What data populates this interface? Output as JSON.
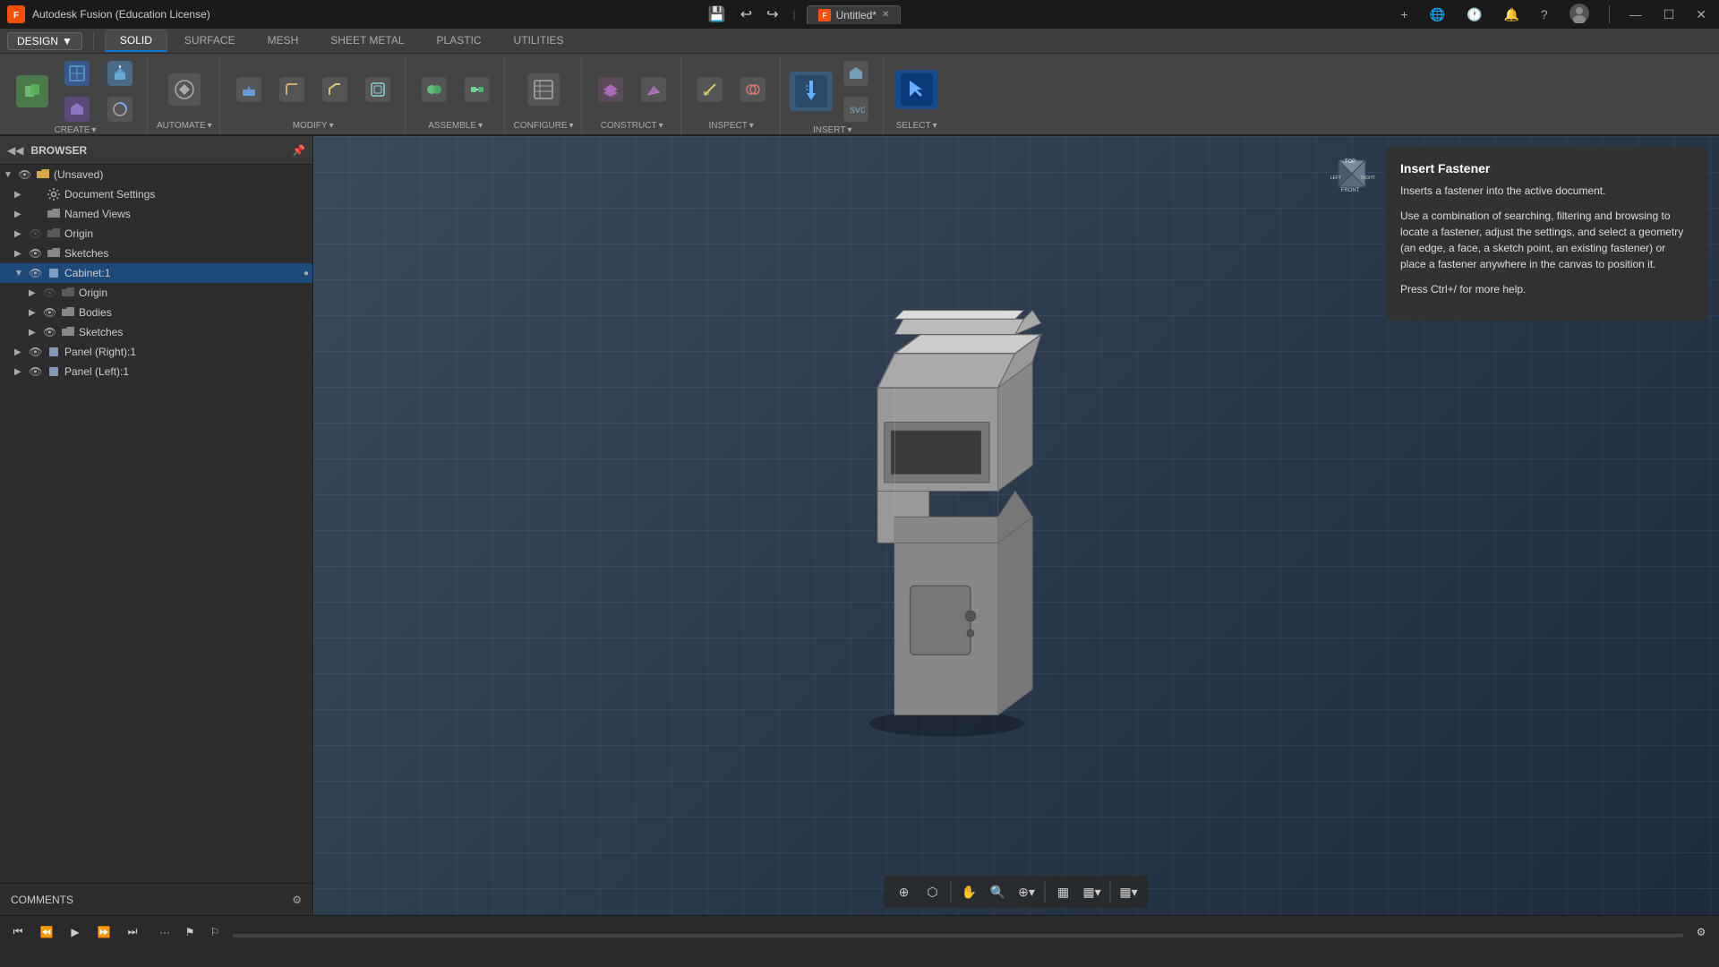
{
  "app": {
    "title": "Autodesk Fusion (Education License)",
    "doc_title": "Untitled*",
    "close_btn": "✕",
    "maximize_btn": "☐",
    "minimize_btn": "—"
  },
  "toolbar": {
    "tabs": [
      "SOLID",
      "SURFACE",
      "MESH",
      "SHEET METAL",
      "PLASTIC",
      "UTILITIES"
    ],
    "active_tab": "SOLID",
    "groups": [
      {
        "label": "CREATE",
        "buttons": [
          "New Component",
          "Create Sketch",
          "Create Form",
          "Extrude"
        ]
      },
      {
        "label": "AUTOMATE",
        "buttons": [
          "Automate"
        ]
      },
      {
        "label": "MODIFY",
        "buttons": [
          "Press Pull",
          "Fillet",
          "Chamfer",
          "Shell"
        ]
      },
      {
        "label": "ASSEMBLE",
        "buttons": [
          "New Joint",
          "As-Built Joint"
        ]
      },
      {
        "label": "CONFIGURE",
        "buttons": [
          "Configure"
        ]
      },
      {
        "label": "CONSTRUCT",
        "buttons": [
          "Offset Plane",
          "Plane at Angle"
        ]
      },
      {
        "label": "INSPECT",
        "buttons": [
          "Measure",
          "Interference"
        ]
      },
      {
        "label": "INSERT",
        "buttons": [
          "Insert Mesh",
          "Insert SVG",
          "Insert Fastener"
        ]
      },
      {
        "label": "SELECT",
        "buttons": [
          "Select"
        ]
      }
    ]
  },
  "design_mode": {
    "label": "DESIGN",
    "arrow": "▼"
  },
  "browser": {
    "title": "BROWSER",
    "items": [
      {
        "id": "unsaved",
        "label": "(Unsaved)",
        "indent": 0,
        "expanded": true,
        "type": "root"
      },
      {
        "id": "doc-settings",
        "label": "Document Settings",
        "indent": 1,
        "type": "settings"
      },
      {
        "id": "named-views",
        "label": "Named Views",
        "indent": 1,
        "type": "folder"
      },
      {
        "id": "origin",
        "label": "Origin",
        "indent": 1,
        "type": "folder",
        "hidden": true
      },
      {
        "id": "sketches",
        "label": "Sketches",
        "indent": 1,
        "type": "folder"
      },
      {
        "id": "cabinet",
        "label": "Cabinet:1",
        "indent": 1,
        "type": "component",
        "selected": true
      },
      {
        "id": "origin2",
        "label": "Origin",
        "indent": 2,
        "type": "folder",
        "hidden": true
      },
      {
        "id": "bodies",
        "label": "Bodies",
        "indent": 2,
        "type": "folder"
      },
      {
        "id": "sketches2",
        "label": "Sketches",
        "indent": 2,
        "type": "folder"
      },
      {
        "id": "panel-right",
        "label": "Panel (Right):1",
        "indent": 1,
        "type": "component"
      },
      {
        "id": "panel-left",
        "label": "Panel (Left):1",
        "indent": 1,
        "type": "component"
      }
    ]
  },
  "tooltip": {
    "title": "Insert Fastener",
    "desc1": "Inserts a fastener into the active document.",
    "desc2": "Use a combination of searching, filtering and browsing to locate a fastener, adjust the settings, and select a geometry (an edge, a face, a sketch point, an existing fastener) or place a fastener anywhere in the canvas to position it.",
    "help_hint": "Press Ctrl+/ for more help."
  },
  "comments": {
    "label": "COMMENTS",
    "add_icon": "⚙"
  },
  "viewport_toolbar": {
    "buttons": [
      "⊕",
      "⬡",
      "✋",
      "🔍",
      "⊕",
      "▦",
      "▦",
      "▦"
    ]
  },
  "bottom_bar": {
    "playback_buttons": [
      "⏮",
      "⏪",
      "▶",
      "⏩",
      "⏭"
    ]
  },
  "header_icons": {
    "new": "+",
    "online": "🌐",
    "history": "🕐",
    "notifications": "🔔",
    "help": "?",
    "profile": "👤"
  }
}
